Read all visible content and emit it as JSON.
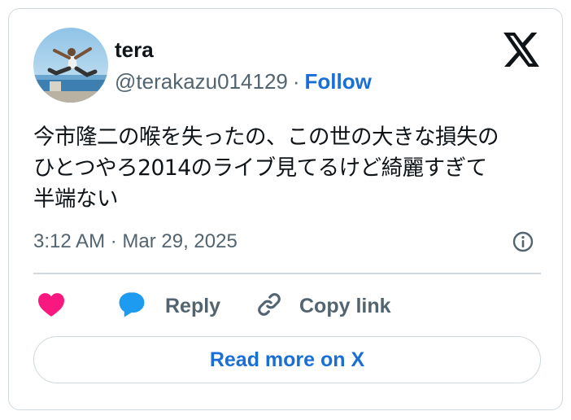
{
  "author": {
    "name": "tera",
    "handle": "@terakazu014129",
    "separator": "·",
    "follow_label": "Follow"
  },
  "tweet": {
    "text_lines": [
      "今市隆二の喉を失ったの、この世の大きな損失の",
      "ひとつやろ2014のライブ見てるけど綺麗すぎて",
      "半端ない"
    ],
    "timestamp": "3:12 AM · Mar 29, 2025"
  },
  "actions": {
    "reply_label": "Reply",
    "copy_label": "Copy link"
  },
  "read_more_label": "Read more on X",
  "colors": {
    "like": "#f91880",
    "reply": "#1d9bf0",
    "link": "#1a6fd6",
    "muted": "#536471",
    "border": "#cfd9de"
  },
  "icons": [
    "x-logo-icon",
    "info-icon",
    "heart-icon",
    "reply-bubble-icon",
    "link-icon"
  ]
}
